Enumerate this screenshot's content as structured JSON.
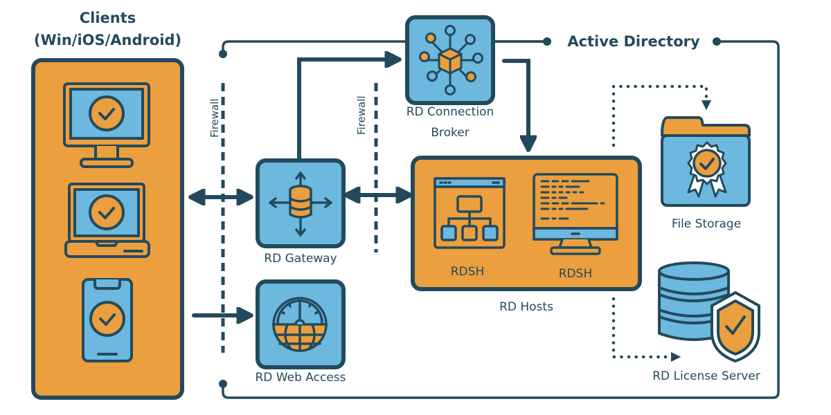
{
  "colors": {
    "navy": "#234a5c",
    "orange": "#ec9f3e",
    "blue": "#6cb8de",
    "white": "#ffffff"
  },
  "clients": {
    "title_line1": "Clients",
    "title_line2": "(Win/iOS/Android)",
    "devices": [
      "desktop-monitor",
      "laptop",
      "smartphone"
    ]
  },
  "firewalls": [
    "Firewall",
    "Firewall"
  ],
  "nodes": {
    "gateway": "RD Gateway",
    "web_access": "RD Web Access",
    "broker_line1": "RD Connection",
    "broker_line2": "Broker",
    "hosts": "RD Hosts",
    "rdsh_1": "RDSH",
    "rdsh_2": "RDSH",
    "active_directory": "Active Directory",
    "file_storage": "File Storage",
    "license_server": "RD License Server"
  },
  "connections": [
    {
      "from": "clients",
      "to": "gateway",
      "style": "bidirectional"
    },
    {
      "from": "clients",
      "to": "web_access",
      "style": "arrow"
    },
    {
      "from": "gateway",
      "to": "broker",
      "style": "arrow"
    },
    {
      "from": "gateway",
      "to": "hosts",
      "style": "bidirectional"
    },
    {
      "from": "broker",
      "to": "hosts",
      "style": "arrow"
    },
    {
      "from": "hosts",
      "to": "file_storage",
      "style": "dotted-arrow"
    },
    {
      "from": "hosts",
      "to": "license_server",
      "style": "dotted-arrow"
    },
    {
      "from": "active_directory",
      "to": "all",
      "style": "frame-line"
    }
  ]
}
